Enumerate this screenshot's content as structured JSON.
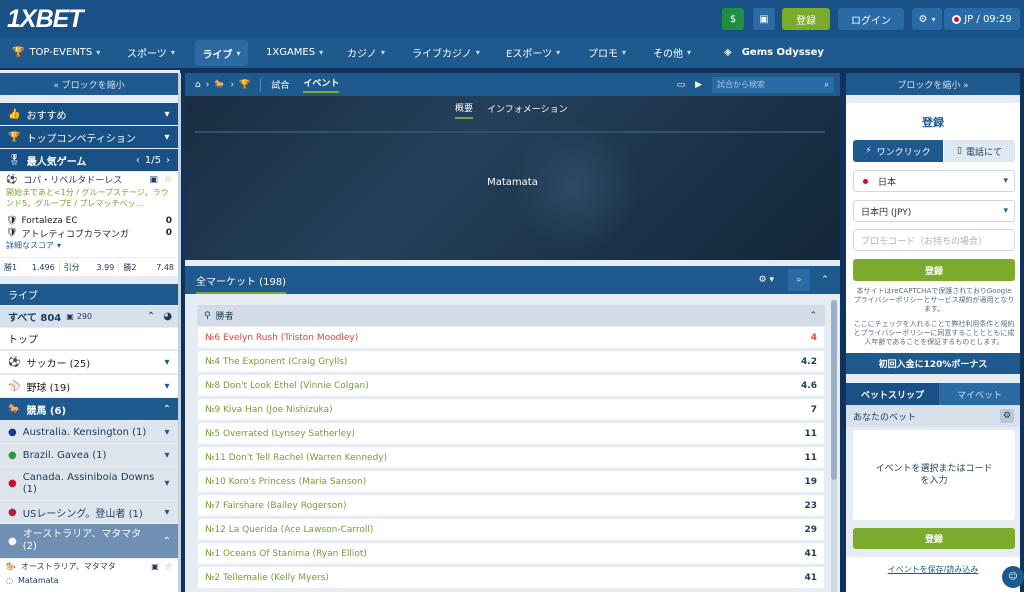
{
  "header": {
    "logo": "1XBET",
    "register": "登録",
    "login": "ログイン",
    "lang": "JP",
    "time": "09:29"
  },
  "nav": [
    {
      "label": "TOP-EVENTS",
      "chevron": true
    },
    {
      "label": "スポーツ",
      "chevron": true
    },
    {
      "label": "ライブ",
      "chevron": true
    },
    {
      "label": "1XGAMES",
      "chevron": true
    },
    {
      "label": "カジノ",
      "chevron": true
    },
    {
      "label": "ライブカジノ",
      "chevron": true
    },
    {
      "label": "Eスポーツ",
      "chevron": true
    },
    {
      "label": "プロモ",
      "chevron": true
    },
    {
      "label": "その他",
      "chevron": true
    },
    {
      "label": "Gems Odyssey",
      "chevron": false
    }
  ],
  "left": {
    "collapse": "« ブロックを縮小",
    "recommended": "おすすめ",
    "top_competitions": "トップコンペティション",
    "popular": "最人気ゲーム",
    "popular_page": "1/5",
    "match": {
      "league": "コパ・リベルタドーレス",
      "info": "開始まであと<1分 / グループステージ。ラウンド5。グループE / プレマッチベッ...",
      "team1": "Fortaleza EC",
      "score1": "0",
      "team2": "アトレティコブカラマンガ",
      "score2": "0",
      "details": "詳細なスコア",
      "odds": [
        {
          "label": "勝1",
          "value": "1.496"
        },
        {
          "label": "引分",
          "value": "3.99"
        },
        {
          "label": "勝2",
          "value": "7.48"
        }
      ]
    },
    "live": "ライブ",
    "all_label": "すべて 804",
    "all_count": "290",
    "top": "トップ",
    "sports": [
      {
        "label": "サッカー (25)"
      },
      {
        "label": "野球 (19)"
      }
    ],
    "horse": "競馬 (6)",
    "races": [
      {
        "label": "Australia. Kensington (1)"
      },
      {
        "label": "Brazil. Gavea (1)"
      },
      {
        "label": "Canada. Assiniboia Downs (1)"
      },
      {
        "label": "USレーシング。登山者 (1)"
      }
    ],
    "selected_race": "オーストラリア、マタマタ (2)",
    "sub_race": "オーストラリア、マタマタ",
    "sub_name": "Matamata"
  },
  "center": {
    "tab_match": "試合",
    "tab_event": "イベント",
    "search_placeholder": "試合から検索",
    "sub_overview": "概要",
    "sub_info": "インフォメーション",
    "venue": "Matamata",
    "all_markets": "全マーケット (198)",
    "group": "勝者",
    "runners": [
      {
        "name": "№6 Evelyn Rush (Triston Moodley)",
        "odd": "4",
        "red": true
      },
      {
        "name": "№4 The Exponent (Craig Grylls)",
        "odd": "4.2"
      },
      {
        "name": "№8 Don't Look Ethel (Vinnie Colgan)",
        "odd": "4.6"
      },
      {
        "name": "№9 Kiva Han (Joe Nishizuka)",
        "odd": "7"
      },
      {
        "name": "№5 Overrated (Lynsey Satherley)",
        "odd": "11"
      },
      {
        "name": "№11 Don't Tell Rachel (Warren Kennedy)",
        "odd": "11"
      },
      {
        "name": "№10 Koro's Princess (Maria Sanson)",
        "odd": "19"
      },
      {
        "name": "№7 Fairshare (Bailey Rogerson)",
        "odd": "23"
      },
      {
        "name": "№12 La Querida (Ace Lawson-Carroll)",
        "odd": "29"
      },
      {
        "name": "№1 Oceans Of Stanima (Ryan Elliot)",
        "odd": "41"
      },
      {
        "name": "№2 Tellemalie (Kelly Myers)",
        "odd": "41"
      }
    ]
  },
  "right": {
    "collapse": "ブロックを縮小 »",
    "reg_title": "登録",
    "oneclick": "ワンクリック",
    "phone": "電話にて",
    "country": "日本",
    "currency": "日本円 (JPY)",
    "promo_placeholder": "プロモコード（お持ちの場合）",
    "register_btn": "登録",
    "recaptcha": "本サイトはreCAPTCHAで保護されておりGoogle プライバシーポリシーとサービス規約が適用となります。",
    "terms": "ここにチェックを入れることで弊社利用条件と規約とプライバシーポリシーに同意することとともに成人年齢であることを保証するものとします。",
    "bonus": "初回入金に120%ボーナス",
    "betslip": "ベットスリップ",
    "mybets": "マイベット",
    "your_bet": "あなたのベット",
    "empty": "イベントを選択またはコードを入力",
    "register2": "登録",
    "save_load": "イベントを保存/読み込み"
  }
}
